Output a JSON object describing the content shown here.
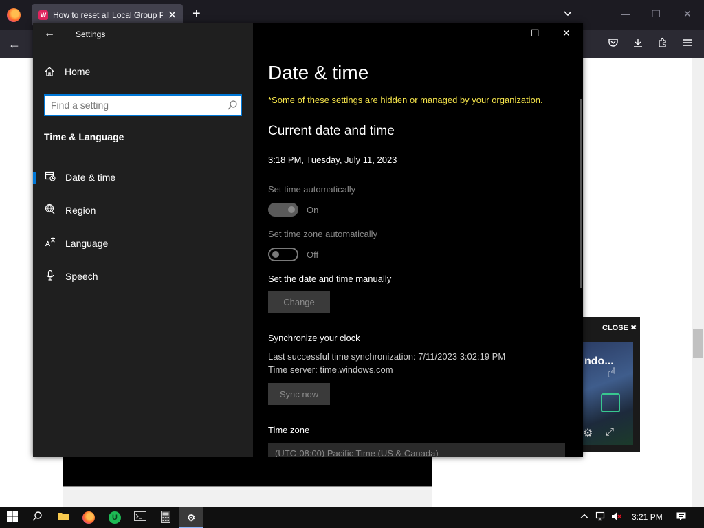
{
  "browser": {
    "tab_title": "How to reset all Local Group Policy settings",
    "tab_close": "✕",
    "new_tab": "+",
    "back": "←",
    "minimize": "—",
    "restore": "❐",
    "close": "✕"
  },
  "ad": {
    "close_label": "CLOSE ✖",
    "video_text": "ndo..."
  },
  "settings": {
    "window_title": "Settings",
    "back": "←",
    "home_label": "Home",
    "search_placeholder": "Find a setting",
    "section_title": "Time & Language",
    "nav": [
      {
        "label": "Date & time",
        "icon": "calendar-clock-icon",
        "active": true
      },
      {
        "label": "Region",
        "icon": "globe-icon",
        "active": false
      },
      {
        "label": "Language",
        "icon": "language-icon",
        "active": false
      },
      {
        "label": "Speech",
        "icon": "microphone-icon",
        "active": false
      }
    ],
    "controls": {
      "minimize": "—",
      "maximize": "☐",
      "close": "✕"
    },
    "main": {
      "title": "Date & time",
      "org_note": "*Some of these settings are hidden or managed by your organization.",
      "current_heading": "Current date and time",
      "current_datetime": "3:18 PM, Tuesday, July 11, 2023",
      "set_time_auto_label": "Set time automatically",
      "set_time_auto_state": "On",
      "set_tz_auto_label": "Set time zone automatically",
      "set_tz_auto_state": "Off",
      "manual_heading": "Set the date and time manually",
      "change_button": "Change",
      "sync_heading": "Synchronize your clock",
      "last_sync": "Last successful time synchronization: 7/11/2023 3:02:19 PM",
      "time_server": "Time server: time.windows.com",
      "sync_button": "Sync now",
      "tz_heading": "Time zone",
      "tz_value": "(UTC-08:00) Pacific Time (US & Canada)"
    }
  },
  "taskbar": {
    "clock": "3:21 PM"
  },
  "colors": {
    "accent": "#0078d7",
    "warning_text": "#f4e34a"
  }
}
